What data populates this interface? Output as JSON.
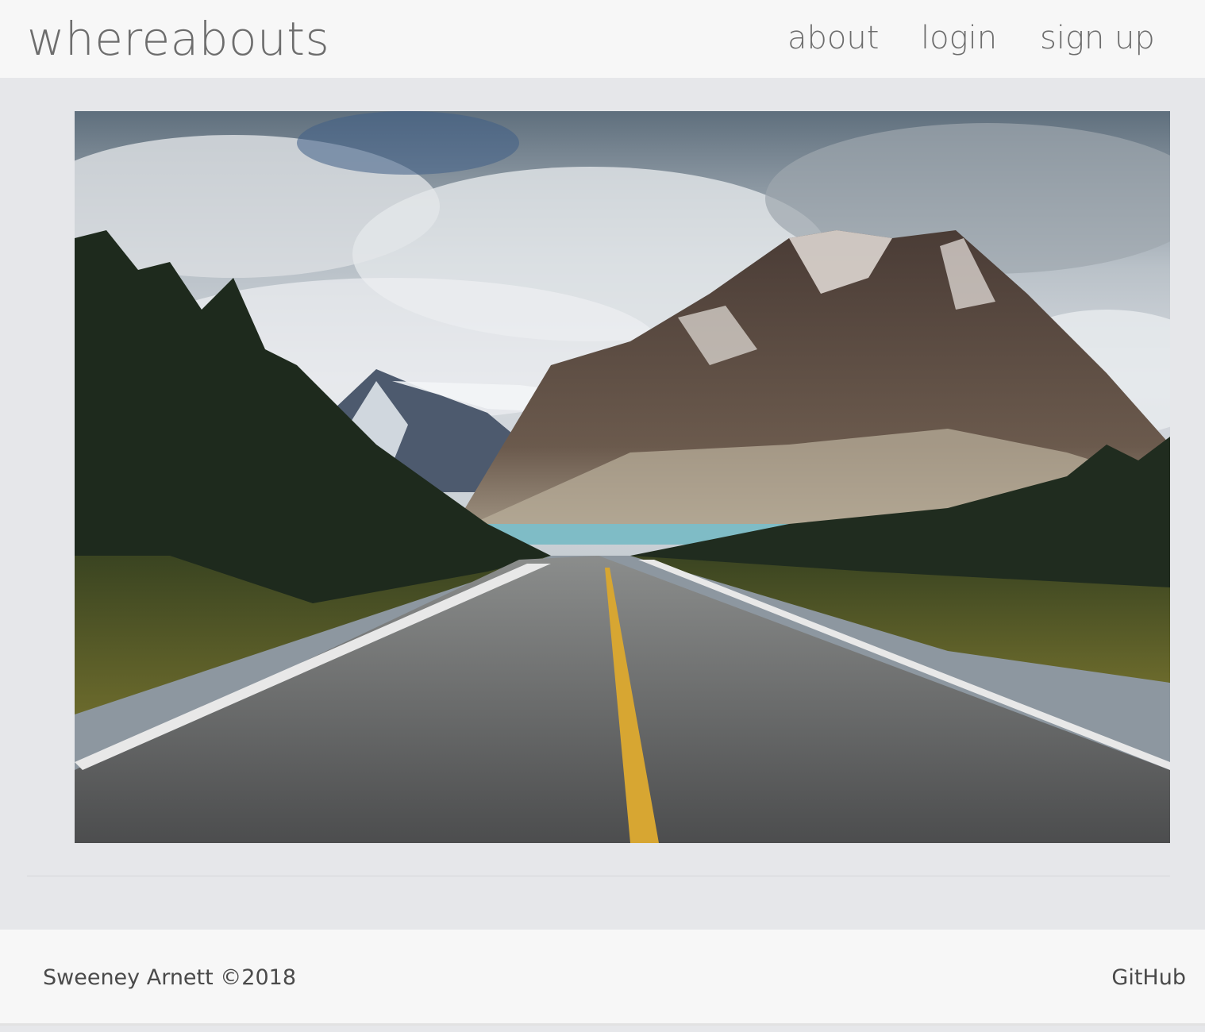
{
  "navbar": {
    "brand": "whereabouts",
    "links": {
      "about": "about",
      "login": "login",
      "signup": "sign up"
    }
  },
  "hero": {
    "icon": "landscape-photo"
  },
  "footer": {
    "copyright": "Sweeney Arnett ©2018",
    "github": "GitHub"
  },
  "colors": {
    "page_background": "#e6e7ea",
    "bar_background": "#f7f7f7",
    "nav_text": "#6d6d6d",
    "footer_text": "#4a4a4a"
  }
}
